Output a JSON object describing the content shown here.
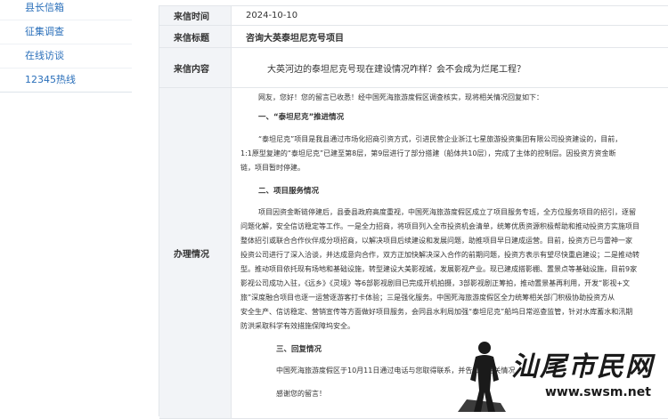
{
  "sidebar": {
    "items": [
      {
        "label": "县长信箱"
      },
      {
        "label": "征集调查"
      },
      {
        "label": "在线访谈"
      },
      {
        "label": "12345热线"
      }
    ]
  },
  "letter": {
    "time_label": "来信时间",
    "time_value": "2024-10-10",
    "title_label": "来信标题",
    "title_value": "咨询大英泰坦尼克号项目",
    "content_label": "来信内容",
    "content_value": "大英河边的泰坦尼克号现在建设情况咋样？会不会成为烂尾工程？",
    "reply_label": "办理情况"
  },
  "reply": {
    "greeting": "网友，您好！您的留言已收悉！经中国死海旅游度假区调查核实，现将相关情况回复如下：",
    "section1_heading": "一、“泰坦尼克”推进情况",
    "section1_lines": [
      "“泰坦尼克”项目是我县通过市场化招商引资方式，引进民营企业浙江七星旅游投资集团有限公司投资建设的，目前，",
      "1:1原型复建的“泰坦尼克”已建至第8层，第9层进行了部分搭建（船体共10层），完成了主体的控制层。因投资方资金断",
      "链，项目暂时停建。"
    ],
    "section2_heading": "二、项目服务情况",
    "section2_lines": [
      "项目因资金断链停建后，县委县政府高度重视，中国死海旅游度假区成立了项目服务专班，全方位服务项目的招引，逐留",
      "问题化解，安全信访稳定等工作。一是全力招商，将项目列入全市投资机会清单，统筹优质资源积极帮助和推动投资方实施项目",
      "整体招引或联合合作伙伴成分项招商，以解决项目后续建设和发展问题，助推项目早日建成运营。目前，投资方已与雷神一家",
      "投资公司进行了深入洽谈，并达成意向合作，双方正加快解决深入合作的前期问题，投资方表示有望尽快重启建设；二是推动转",
      "型。推动项目依托现有场地和基础设施，转型建设大美影视城，发展影视产业。现已建成搭影棚、置景点等基础设施，目前9家",
      "影视公司成功入驻，《远乡》《灵境》等6部影视剧目已完成开机拍摄，3部影视剧正筹拍，推动置景基再利用，开发“影视+文",
      "旅”深度融合项目也逐一运营逐游客打卡体验；三是强化服务。中国死海旅游度假区全力统筹相关部门积极协助投资方从",
      "安全生产、信访稳定、营销宣传等方面做好项目服务，会同县水利局加强“泰坦尼克”船坞日常巡查监管，针对水库蓄水和汛期",
      "防洪采取科学有效措施保障坞安全。"
    ],
    "section3_heading": "三、回复情况",
    "section3_lines": [
      "中国死海旅游度假区于10月11日通过电话与您取得联系，并告知您相关情况"
    ],
    "closing": "感谢您的留言！"
  },
  "watermark": {
    "title": "汕尾市民网",
    "url": "www.swsm.net"
  }
}
